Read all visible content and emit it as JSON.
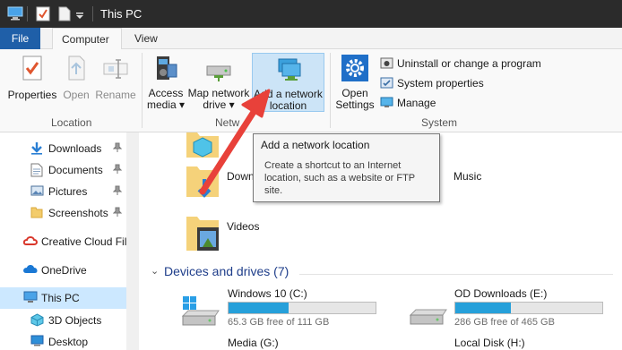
{
  "window": {
    "title": "This PC"
  },
  "tabs": {
    "file": "File",
    "computer": "Computer",
    "view": "View"
  },
  "ribbon": {
    "location": {
      "label": "Location",
      "properties": "Properties",
      "open": "Open",
      "rename": "Rename"
    },
    "network": {
      "label": "Netw",
      "access_media": [
        "Access",
        "media ▾"
      ],
      "map_drive": [
        "Map network",
        "drive ▾"
      ],
      "add_location": [
        "Add a network",
        "location"
      ]
    },
    "system": {
      "label": "System",
      "open_settings": [
        "Open",
        "Settings"
      ],
      "uninstall": "Uninstall or change a program",
      "system_properties": "System properties",
      "manage": "Manage"
    }
  },
  "nav": {
    "items": [
      {
        "label": "Downloads",
        "pinned": true
      },
      {
        "label": "Documents",
        "pinned": true
      },
      {
        "label": "Pictures",
        "pinned": true
      },
      {
        "label": "Screenshots",
        "pinned": true
      },
      {
        "label": "Creative Cloud Fil",
        "pinned": false
      },
      {
        "label": "OneDrive",
        "pinned": false
      },
      {
        "label": "This PC",
        "pinned": false,
        "selected": true
      },
      {
        "label": "3D Objects",
        "pinned": false
      },
      {
        "label": "Desktop",
        "pinned": false
      }
    ]
  },
  "content": {
    "folders": {
      "downloads_partial": "Down",
      "music": "Music",
      "videos": "Videos"
    },
    "devices_header": "Devices and drives (7)",
    "drives": [
      {
        "name": "Windows 10 (C:)",
        "free": "65.3 GB free of 111 GB",
        "used_fraction": 0.41
      },
      {
        "name": "OD Downloads  (E:)",
        "free": "286 GB free of 465 GB",
        "used_fraction": 0.38
      },
      {
        "name": "Media (G:)",
        "free": "",
        "used_fraction": 0
      },
      {
        "name": "Local Disk (H:)",
        "free": "",
        "used_fraction": 0
      }
    ]
  },
  "tooltip": {
    "title": "Add a network location",
    "description": "Create a shortcut to an Internet location, such as a website or FTP site."
  },
  "colors": {
    "accent": "#1f5fa8",
    "drive_fill": "#26a0da",
    "arrow": "#e8413a",
    "highlight": "#cce4f7"
  }
}
